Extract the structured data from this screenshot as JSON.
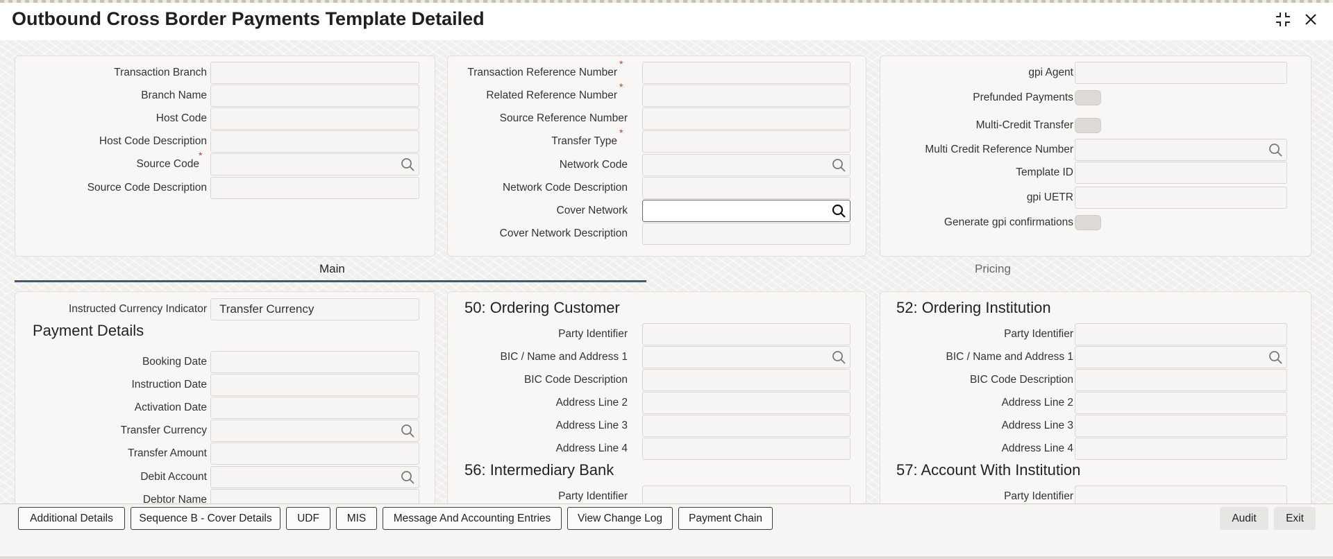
{
  "window": {
    "title": "Outbound Cross Border Payments Template Detailed",
    "icons": [
      "maximize-icon",
      "close-icon"
    ]
  },
  "header_panel_1": {
    "fields": [
      {
        "label": "Transaction Branch",
        "value": "",
        "required": false
      },
      {
        "label": "Branch Name",
        "value": "",
        "required": false
      },
      {
        "label": "Host Code",
        "value": "",
        "required": false
      },
      {
        "label": "Host Code Description",
        "value": "",
        "required": false
      },
      {
        "label": "Source Code",
        "value": "",
        "required": true,
        "lookup": true
      },
      {
        "label": "Source Code Description",
        "value": "",
        "required": false
      }
    ]
  },
  "header_panel_2": {
    "fields": [
      {
        "label": "Transaction Reference Number",
        "value": "",
        "required": true
      },
      {
        "label": "Related Reference Number",
        "value": "",
        "required": true
      },
      {
        "label": "Source Reference Number",
        "value": "",
        "required": false
      },
      {
        "label": "Transfer Type",
        "value": "",
        "required": true
      },
      {
        "label": "Network Code",
        "value": "",
        "required": false,
        "lookup": true
      },
      {
        "label": "Network Code Description",
        "value": "",
        "required": false
      },
      {
        "label": "Cover Network",
        "value": "",
        "required": false,
        "lookup": true,
        "active": true
      },
      {
        "label": "Cover Network Description",
        "value": "",
        "required": false
      }
    ]
  },
  "header_panel_3": {
    "gpi_agent": {
      "label": "gpi Agent",
      "value": ""
    },
    "prefunded_payments": {
      "label": "Prefunded Payments",
      "on": false
    },
    "multi_credit_transfer": {
      "label": "Multi-Credit Transfer",
      "on": false
    },
    "multi_credit_reference_number": {
      "label": "Multi Credit Reference Number",
      "value": ""
    },
    "template_id": {
      "label": "Template ID",
      "value": ""
    },
    "gpi_uetr": {
      "label": "gpi UETR",
      "value": ""
    },
    "generate_gpi_confirmations": {
      "label": "Generate gpi confirmations",
      "on": false
    }
  },
  "tabs": [
    {
      "label": "Main",
      "active": true
    },
    {
      "label": "Pricing",
      "active": false
    }
  ],
  "main": {
    "instructed_currency_indicator": {
      "label": "Instructed Currency Indicator",
      "value": "Transfer Currency"
    },
    "payment_details": {
      "title": "Payment Details",
      "fields": [
        {
          "label": "Booking Date",
          "value": ""
        },
        {
          "label": "Instruction Date",
          "value": ""
        },
        {
          "label": "Activation Date",
          "value": ""
        },
        {
          "label": "Transfer Currency",
          "value": "",
          "lookup": true
        },
        {
          "label": "Transfer Amount",
          "value": ""
        },
        {
          "label": "Debit Account",
          "value": "",
          "lookup": true
        },
        {
          "label": "Debtor Name",
          "value": ""
        }
      ]
    },
    "ordering_customer": {
      "title": "50: Ordering Customer",
      "fields": [
        {
          "label": "Party Identifier",
          "value": ""
        },
        {
          "label": "BIC / Name and Address 1",
          "value": "",
          "lookup": true
        },
        {
          "label": "BIC Code Description",
          "value": ""
        },
        {
          "label": "Address Line 2",
          "value": ""
        },
        {
          "label": "Address Line 3",
          "value": ""
        },
        {
          "label": "Address Line 4",
          "value": ""
        }
      ]
    },
    "intermediary_bank": {
      "title": "56: Intermediary Bank",
      "fields": [
        {
          "label": "Party Identifier",
          "value": ""
        }
      ]
    },
    "ordering_institution": {
      "title": "52: Ordering Institution",
      "fields": [
        {
          "label": "Party Identifier",
          "value": ""
        },
        {
          "label": "BIC / Name and Address 1",
          "value": "",
          "lookup": true
        },
        {
          "label": "BIC Code Description",
          "value": ""
        },
        {
          "label": "Address Line 2",
          "value": ""
        },
        {
          "label": "Address Line 3",
          "value": ""
        },
        {
          "label": "Address Line 4",
          "value": ""
        }
      ]
    },
    "account_with_institution": {
      "title": "57: Account With Institution",
      "fields": [
        {
          "label": "Party Identifier",
          "value": ""
        }
      ]
    }
  },
  "footer": {
    "buttons": [
      "Additional Details",
      "Sequence B - Cover Details",
      "UDF",
      "MIS",
      "Message And Accounting Entries",
      "View Change Log",
      "Payment Chain"
    ],
    "audit_label": "Audit",
    "exit_label": "Exit"
  }
}
